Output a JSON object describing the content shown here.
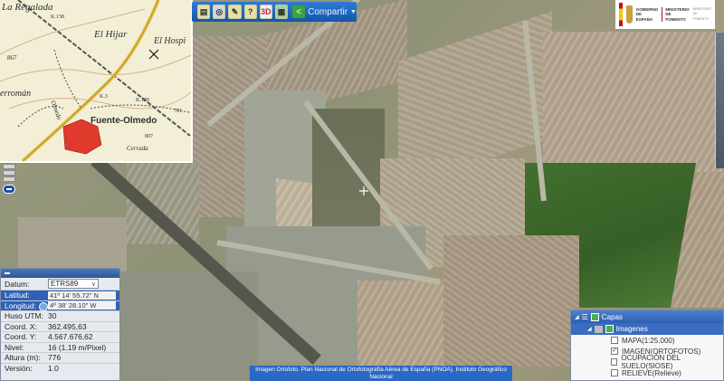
{
  "toolbar": {
    "share_label": "Compartir",
    "buttons": [
      "layers-button",
      "home-button",
      "measure-button",
      "info-button",
      "3d-button",
      "print-button"
    ],
    "button_3d": "3D"
  },
  "inset_map": {
    "labels": [
      "La Regalada",
      "K.138",
      "El Hijar",
      "El Hospi",
      "867",
      "Fuente-Olmedo",
      "erromán",
      "K.129",
      "K.3",
      "781",
      "807",
      "Cerrada",
      "Olmedo"
    ]
  },
  "coords": {
    "datum_label": "Datum:",
    "datum_value": "ETRS89",
    "lat_label": "Latitud:",
    "lat_value": "41º 14' 55.72\" N",
    "lon_label": "Longitud:",
    "lon_value": "4º 38' 28.10\" W",
    "huso_label": "Huso UTM:",
    "huso_value": "30",
    "x_label": "Coord. X:",
    "x_value": "362.495,63",
    "y_label": "Coord. Y:",
    "y_value": "4.567.676,62",
    "nivel_label": "Nivel:",
    "nivel_value": "16 (1.19 m/Pixel)",
    "altura_label": "Altura (m):",
    "altura_value": "776",
    "version_label": "Versión:",
    "version_value": "1.0"
  },
  "layers": {
    "title": "Capas",
    "group": "Imagenes",
    "items": [
      {
        "label": "MAPA(1:25.000)",
        "checked": false
      },
      {
        "label": "IMAGEN(ORTOFOTOS)",
        "checked": true
      },
      {
        "label": "OCUPACIÓN DEL SUELO(SIOSE)",
        "checked": false
      },
      {
        "label": "RELIEVE(Relieve)",
        "checked": false
      }
    ]
  },
  "logo": {
    "line1": "GOBIERNO",
    "line2": "DE ESPAÑA",
    "line3": "MINISTERIO",
    "line4": "DE FOMENTO",
    "line5": "MINISTERIO",
    "line6": "DE FOMENTO"
  },
  "attribution": {
    "line1": "Imagen Ortofoto. Plan Nacional de Ortofotografía Aérea de España (PNOA). Instituto Geográfico",
    "line2": "Nacional"
  },
  "colors": {
    "accent": "#2a68c4",
    "panel": "#e6eaef",
    "field_green": "#3f6e2a"
  }
}
